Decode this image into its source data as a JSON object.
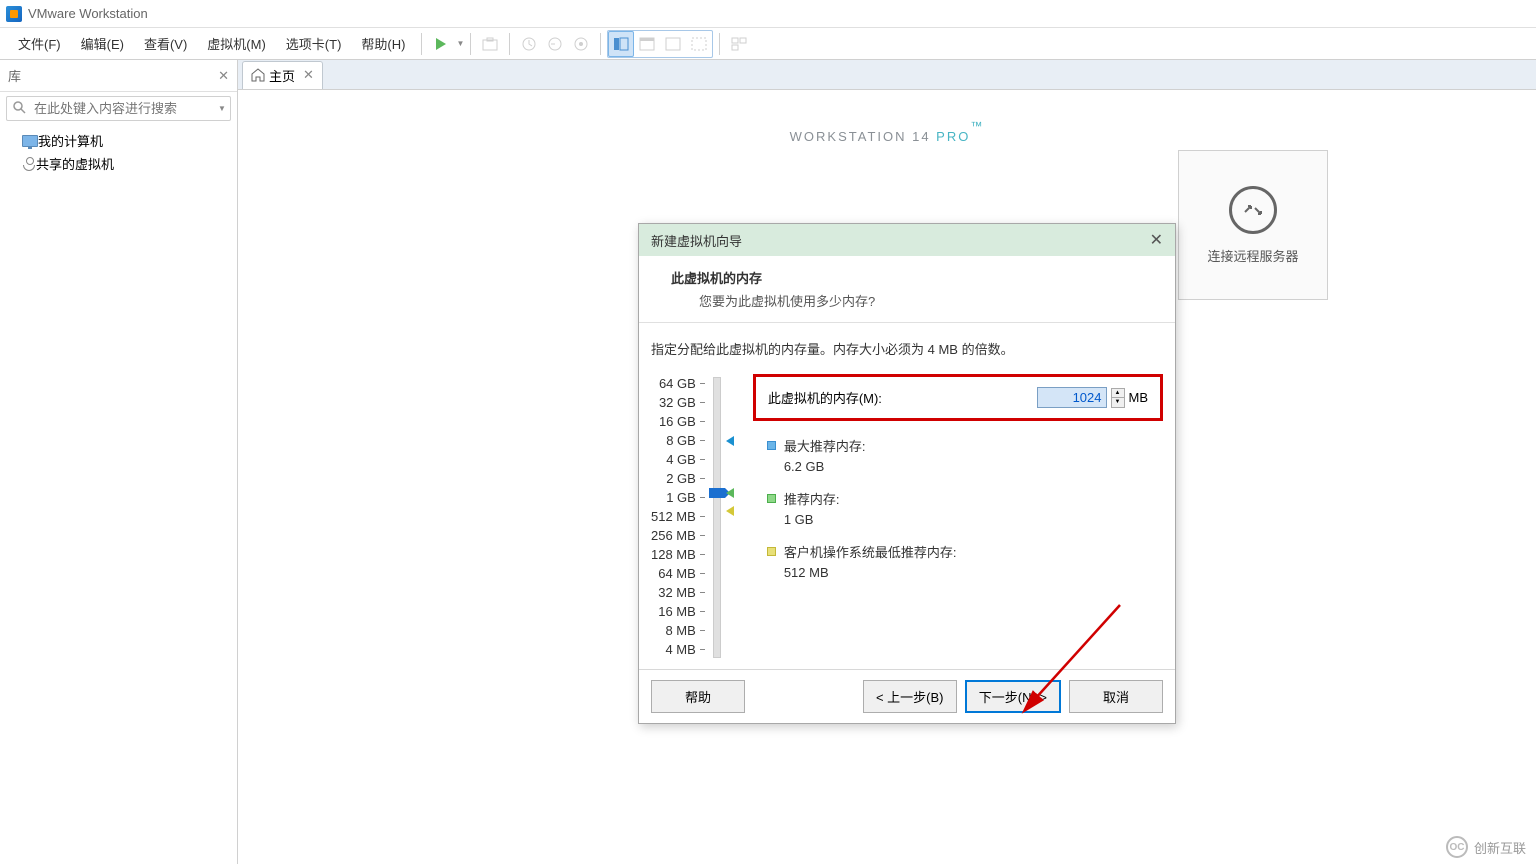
{
  "window": {
    "title": "VMware Workstation"
  },
  "menu": {
    "file": "文件(F)",
    "edit": "编辑(E)",
    "view": "查看(V)",
    "vm": "虚拟机(M)",
    "tabs": "选项卡(T)",
    "help": "帮助(H)"
  },
  "sidebar": {
    "title": "库",
    "search_placeholder": "在此处键入内容进行搜索",
    "items": {
      "my_computer": "我的计算机",
      "shared": "共享的虚拟机"
    }
  },
  "tab": {
    "home": "主页"
  },
  "page": {
    "title_part1": "WORKSTATION 14 ",
    "title_part2": "PRO",
    "title_tm": "™",
    "tile_label": "连接远程服务器"
  },
  "dialog": {
    "title": "新建虚拟机向导",
    "header_title": "此虚拟机的内存",
    "header_sub": "您要为此虚拟机使用多少内存?",
    "instruction": "指定分配给此虚拟机的内存量。内存大小必须为 4 MB 的倍数。",
    "mem_label": "此虚拟机的内存(M):",
    "mem_value": "1024",
    "mem_unit": "MB",
    "ruler": [
      "64 GB",
      "32 GB",
      "16 GB",
      "8 GB",
      "4 GB",
      "2 GB",
      "1 GB",
      "512 MB",
      "256 MB",
      "128 MB",
      "64 MB",
      "32 MB",
      "16 MB",
      "8 MB",
      "4 MB"
    ],
    "rec_max_label": "最大推荐内存:",
    "rec_max_value": "6.2 GB",
    "rec_label": "推荐内存:",
    "rec_value": "1 GB",
    "rec_min_label": "客户机操作系统最低推荐内存:",
    "rec_min_value": "512 MB",
    "btn_help": "帮助",
    "btn_back": "< 上一步(B)",
    "btn_next": "下一步(N) >",
    "btn_cancel": "取消"
  },
  "watermark": "创新互联"
}
